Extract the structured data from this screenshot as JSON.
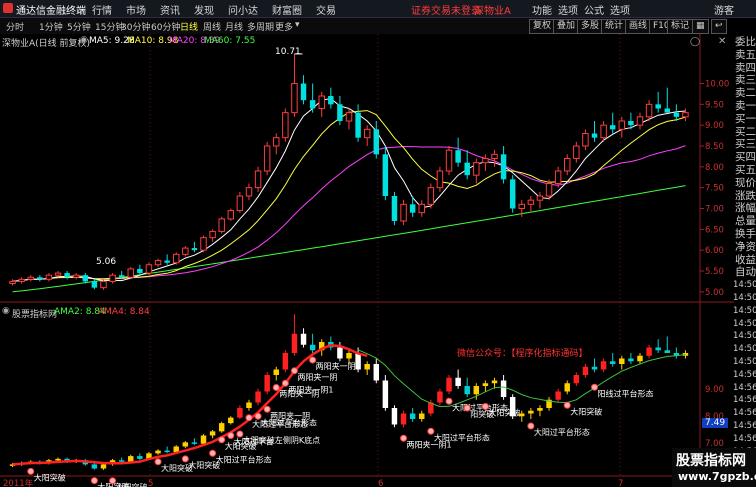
{
  "titlebar": {
    "app_name": "通达信金融终端",
    "menus": [
      "行情",
      "市场",
      "资讯",
      "发现",
      "问小达",
      "财富圈",
      "交易"
    ],
    "alert": "证券交易未登录",
    "stock_tag": "深物业A",
    "right_menus": [
      "功能",
      "选项",
      "公式",
      "选项",
      "游客"
    ]
  },
  "toolbar": {
    "periods": [
      "分时",
      "1分钟",
      "5分钟",
      "15分钟",
      "30分钟",
      "60分钟",
      "日线",
      "周线",
      "月线",
      "多周期",
      "更多"
    ],
    "active_period": "日线",
    "right_buttons": [
      "复权",
      "叠加",
      "多股",
      "统计",
      "画线",
      "F10",
      "标记"
    ]
  },
  "main_chart": {
    "title": "深物业A(日线 前复权)",
    "ma_labels": [
      {
        "text": "MA5: 9.28",
        "color": "#ffffff"
      },
      {
        "text": "MA10: 8.98",
        "color": "#ffff40"
      },
      {
        "text": "MA20: 8.39",
        "color": "#ff40ff"
      },
      {
        "text": "MA60: 7.55",
        "color": "#40ff40"
      }
    ],
    "high_label": "10.71",
    "low_label": "5.06",
    "y_ticks": [
      "10.00",
      "9.50",
      "9.00",
      "8.50",
      "8.00",
      "7.50",
      "7.00",
      "6.50",
      "6.00",
      "5.50",
      "5.00"
    ]
  },
  "indicator_panel": {
    "title": "股票指标网",
    "ama2": "AMA2: 8.84",
    "ama4": "AMA4: 8.84",
    "y_ticks": [
      "9.00",
      "8.00",
      "7.00",
      "6.00"
    ],
    "current_value": "7.49",
    "notice": "微信公众号：【程序化指标通码】",
    "signals": [
      "大阳突破",
      "大阳突破",
      "大阳突破",
      "大阳突破",
      "大阳突破",
      "大阳过平台形态",
      "大阳突破",
      "大阳过平台",
      "大阳突破左侧阴K底点",
      "大阳过平台形态",
      "大阳过平台形态",
      "两阳夹一阴",
      "两阳夹一阴",
      "两阳夹一阴1",
      "两阳夹一阴",
      "两阳夹一阴1",
      "两阳夹一阴1",
      "大阳过平台形态",
      "大阳过平台形态",
      "阳突破",
      "大阳突破",
      "大阳过平台形态",
      "大阳突破",
      "阳线过平台形态"
    ]
  },
  "x_axis": {
    "labels": [
      "2011年",
      "5",
      "6",
      "7"
    ]
  },
  "sidebar": {
    "items": [
      "委比",
      "卖五",
      "卖四",
      "卖三",
      "卖二",
      "卖一",
      "买一",
      "买二",
      "买三",
      "买四",
      "买五",
      "现价",
      "涨跌",
      "涨幅",
      "总量",
      "换手",
      "净资",
      "收益",
      "自动",
      "14:50",
      "14:50",
      "14:50",
      "14:50",
      "14:50",
      "14:50",
      "14:50",
      "14:56",
      "14:56",
      "14:56",
      "14:56",
      "14:56",
      "14:56",
      "14:56",
      "14:56",
      "游客"
    ]
  },
  "watermark": {
    "line1": "股票指标网",
    "line2": "www.7gpzb.com"
  },
  "colors": {
    "up": "#ff3c3c",
    "down": "#00e0e0",
    "ma5": "#ffffff",
    "ma10": "#ffff40",
    "ma20": "#ff40ff",
    "ma60": "#40ff40",
    "grid": "#8a1a1a"
  },
  "chart_data": {
    "type": "candlestick",
    "candles": [
      [
        5.2,
        5.3,
        5.15,
        5.25
      ],
      [
        5.25,
        5.35,
        5.2,
        5.3
      ],
      [
        5.3,
        5.4,
        5.25,
        5.35
      ],
      [
        5.35,
        5.4,
        5.25,
        5.3
      ],
      [
        5.3,
        5.45,
        5.25,
        5.4
      ],
      [
        5.4,
        5.5,
        5.35,
        5.45
      ],
      [
        5.45,
        5.5,
        5.3,
        5.35
      ],
      [
        5.35,
        5.45,
        5.3,
        5.4
      ],
      [
        5.4,
        5.45,
        5.2,
        5.25
      ],
      [
        5.25,
        5.3,
        5.06,
        5.1
      ],
      [
        5.1,
        5.3,
        5.05,
        5.25
      ],
      [
        5.25,
        5.45,
        5.2,
        5.4
      ],
      [
        5.4,
        5.5,
        5.3,
        5.35
      ],
      [
        5.35,
        5.6,
        5.3,
        5.55
      ],
      [
        5.55,
        5.65,
        5.4,
        5.45
      ],
      [
        5.45,
        5.7,
        5.4,
        5.65
      ],
      [
        5.65,
        5.8,
        5.6,
        5.75
      ],
      [
        5.75,
        5.9,
        5.65,
        5.7
      ],
      [
        5.7,
        5.95,
        5.65,
        5.9
      ],
      [
        5.9,
        6.1,
        5.85,
        6.05
      ],
      [
        6.05,
        6.2,
        5.95,
        6.0
      ],
      [
        6.0,
        6.35,
        5.95,
        6.3
      ],
      [
        6.3,
        6.5,
        6.2,
        6.45
      ],
      [
        6.45,
        6.8,
        6.4,
        6.75
      ],
      [
        6.75,
        7.0,
        6.7,
        6.95
      ],
      [
        6.95,
        7.4,
        6.9,
        7.3
      ],
      [
        7.3,
        7.6,
        7.2,
        7.5
      ],
      [
        7.5,
        8.0,
        7.4,
        7.9
      ],
      [
        7.9,
        8.6,
        7.8,
        8.5
      ],
      [
        8.5,
        8.8,
        8.3,
        8.7
      ],
      [
        8.7,
        9.4,
        8.6,
        9.3
      ],
      [
        9.3,
        10.71,
        9.2,
        10.0
      ],
      [
        10.0,
        10.2,
        9.5,
        9.6
      ],
      [
        9.6,
        10.0,
        9.3,
        9.4
      ],
      [
        9.4,
        9.8,
        9.2,
        9.7
      ],
      [
        9.7,
        9.9,
        9.4,
        9.5
      ],
      [
        9.5,
        9.7,
        9.0,
        9.1
      ],
      [
        9.1,
        9.4,
        8.9,
        9.3
      ],
      [
        9.3,
        9.5,
        8.6,
        8.7
      ],
      [
        8.7,
        9.0,
        8.5,
        8.9
      ],
      [
        8.9,
        9.1,
        8.2,
        8.3
      ],
      [
        8.3,
        8.5,
        7.2,
        7.3
      ],
      [
        7.3,
        7.4,
        6.6,
        6.7
      ],
      [
        6.7,
        7.2,
        6.6,
        7.1
      ],
      [
        7.1,
        7.3,
        6.8,
        6.9
      ],
      [
        6.9,
        7.2,
        6.8,
        7.1
      ],
      [
        7.1,
        7.6,
        7.0,
        7.5
      ],
      [
        7.5,
        8.0,
        7.4,
        7.9
      ],
      [
        7.9,
        8.5,
        7.8,
        8.4
      ],
      [
        8.4,
        8.7,
        8.0,
        8.1
      ],
      [
        8.1,
        8.4,
        7.7,
        7.8
      ],
      [
        7.8,
        8.2,
        7.6,
        8.1
      ],
      [
        8.1,
        8.3,
        7.9,
        8.2
      ],
      [
        8.2,
        8.4,
        8.0,
        8.3
      ],
      [
        8.3,
        8.5,
        7.6,
        7.7
      ],
      [
        7.7,
        7.8,
        6.9,
        7.0
      ],
      [
        7.0,
        7.2,
        6.8,
        7.1
      ],
      [
        7.1,
        7.3,
        6.9,
        7.2
      ],
      [
        7.2,
        7.4,
        7.0,
        7.3
      ],
      [
        7.3,
        7.7,
        7.2,
        7.6
      ],
      [
        7.6,
        8.0,
        7.5,
        7.9
      ],
      [
        7.9,
        8.3,
        7.8,
        8.2
      ],
      [
        8.2,
        8.6,
        8.1,
        8.5
      ],
      [
        8.5,
        8.9,
        8.4,
        8.8
      ],
      [
        8.8,
        9.1,
        8.6,
        8.7
      ],
      [
        8.7,
        9.1,
        8.6,
        9.0
      ],
      [
        9.0,
        9.3,
        8.8,
        8.9
      ],
      [
        8.9,
        9.2,
        8.7,
        9.1
      ],
      [
        9.1,
        9.3,
        8.9,
        9.0
      ],
      [
        9.0,
        9.3,
        8.9,
        9.2
      ],
      [
        9.2,
        9.6,
        9.1,
        9.5
      ],
      [
        9.5,
        9.8,
        9.3,
        9.4
      ],
      [
        9.4,
        9.9,
        9.3,
        9.3
      ],
      [
        9.3,
        9.5,
        9.1,
        9.2
      ],
      [
        9.2,
        9.4,
        9.1,
        9.3
      ]
    ],
    "ylim": [
      4.9,
      10.9
    ]
  }
}
